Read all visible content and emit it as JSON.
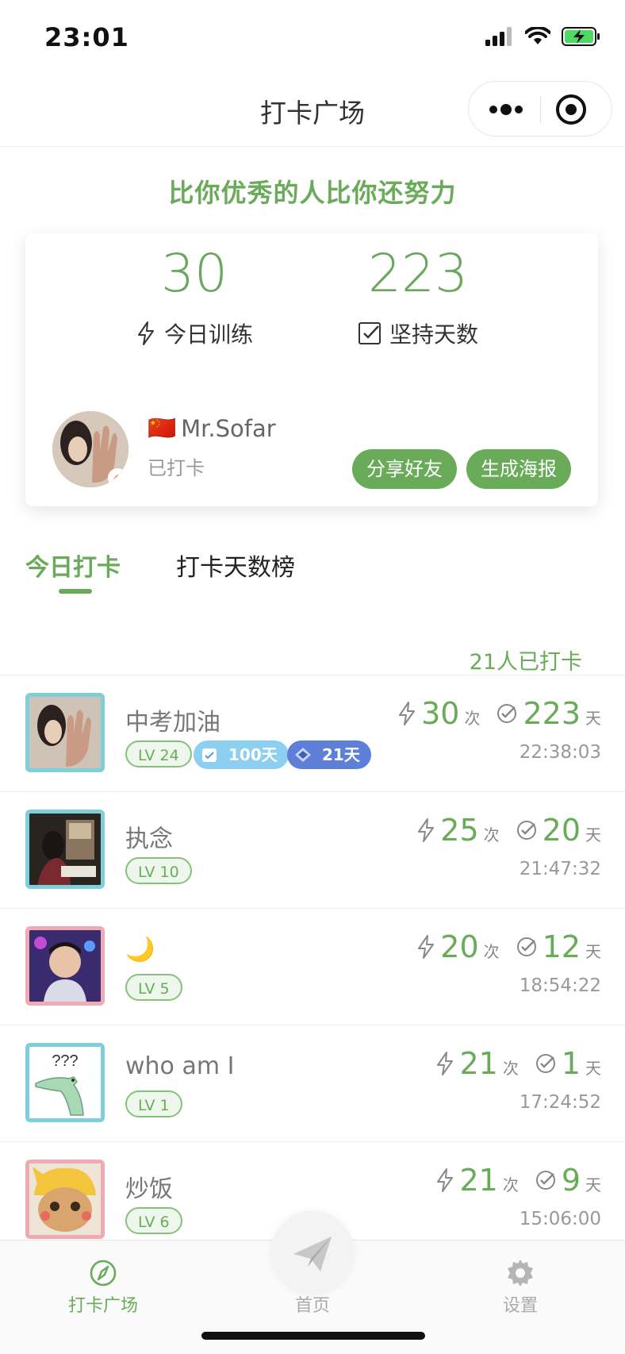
{
  "status_bar": {
    "time": "23:01"
  },
  "navbar": {
    "title": "打卡广场"
  },
  "slogan": "比你优秀的人比你还努力",
  "summary": {
    "today_training_value": "30",
    "today_training_label": "今日训练",
    "days_value": "223",
    "days_label": "坚持天数",
    "flag": "🇨🇳",
    "user_name": "Mr.Sofar",
    "user_status": "已打卡",
    "share_button": "分享好友",
    "poster_button": "生成海报"
  },
  "tabs": [
    {
      "label": "今日打卡",
      "active": true
    },
    {
      "label": "打卡天数榜",
      "active": false
    }
  ],
  "checkin_count": "21人已打卡",
  "entries": [
    {
      "name": "中考加油",
      "level": "LV 24",
      "badges": [
        "100天",
        "21天"
      ],
      "times": "30",
      "times_unit": "次",
      "days": "223",
      "days_unit": "天",
      "time": "22:38:03"
    },
    {
      "name": "执念",
      "level": "LV 10",
      "badges": [],
      "times": "25",
      "times_unit": "次",
      "days": "20",
      "days_unit": "天",
      "time": "21:47:32"
    },
    {
      "name": "🌙",
      "level": "LV 5",
      "badges": [],
      "times": "20",
      "times_unit": "次",
      "days": "12",
      "days_unit": "天",
      "time": "18:54:22"
    },
    {
      "name": "who am I",
      "level": "LV 1",
      "badges": [],
      "times": "21",
      "times_unit": "次",
      "days": "1",
      "days_unit": "天",
      "time": "17:24:52"
    },
    {
      "name": "炒饭",
      "level": "LV 6",
      "badges": [],
      "times": "21",
      "times_unit": "次",
      "days": "9",
      "days_unit": "天",
      "time": "15:06:00"
    }
  ],
  "avatar4_text": "???",
  "tabbar": {
    "square": "打卡广场",
    "home": "首页",
    "settings": "设置"
  },
  "colors": {
    "accent": "#6aab5a",
    "badge_blue_light": "#8ccff0",
    "badge_blue_dark": "#5d7fd8"
  }
}
